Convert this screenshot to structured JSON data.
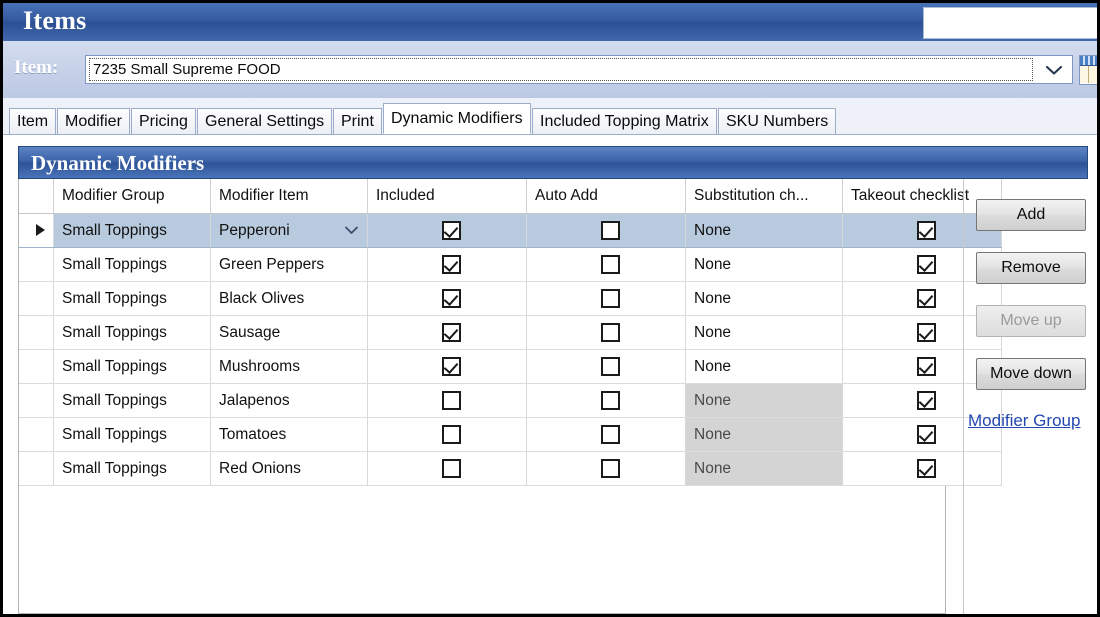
{
  "window": {
    "title": "Items"
  },
  "item_bar": {
    "label": "Item:",
    "value": "7235 Small Supreme FOOD",
    "placeholder": "",
    "dropdown_icon": "chevron-down-icon",
    "grid_icon": "table-grid-icon"
  },
  "tabs": [
    {
      "label": "Item",
      "active": false
    },
    {
      "label": "Modifier",
      "active": false
    },
    {
      "label": "Pricing",
      "active": false
    },
    {
      "label": "General Settings",
      "active": false
    },
    {
      "label": "Print",
      "active": false
    },
    {
      "label": "Dynamic Modifiers",
      "active": true
    },
    {
      "label": "Included Topping Matrix",
      "active": false
    },
    {
      "label": "SKU Numbers",
      "active": false
    }
  ],
  "panel": {
    "header": "Dynamic Modifiers"
  },
  "grid": {
    "columns": [
      "Modifier Group",
      "Modifier Item",
      "Included",
      "Auto Add",
      "Substitution ch...",
      "Takeout checklist"
    ],
    "rows": [
      {
        "selected": true,
        "dropdown": true,
        "modifier_group": "Small Toppings",
        "modifier_item": "Pepperoni",
        "included": true,
        "auto_add": false,
        "substitution": "None",
        "substitution_disabled": false,
        "takeout": true
      },
      {
        "selected": false,
        "dropdown": false,
        "modifier_group": "Small Toppings",
        "modifier_item": "Green Peppers",
        "included": true,
        "auto_add": false,
        "substitution": "None",
        "substitution_disabled": false,
        "takeout": true
      },
      {
        "selected": false,
        "dropdown": false,
        "modifier_group": "Small Toppings",
        "modifier_item": "Black Olives",
        "included": true,
        "auto_add": false,
        "substitution": "None",
        "substitution_disabled": false,
        "takeout": true
      },
      {
        "selected": false,
        "dropdown": false,
        "modifier_group": "Small Toppings",
        "modifier_item": "Sausage",
        "included": true,
        "auto_add": false,
        "substitution": "None",
        "substitution_disabled": false,
        "takeout": true
      },
      {
        "selected": false,
        "dropdown": false,
        "modifier_group": "Small Toppings",
        "modifier_item": "Mushrooms",
        "included": true,
        "auto_add": false,
        "substitution": "None",
        "substitution_disabled": false,
        "takeout": true
      },
      {
        "selected": false,
        "dropdown": false,
        "modifier_group": "Small Toppings",
        "modifier_item": "Jalapenos",
        "included": false,
        "auto_add": false,
        "substitution": "None",
        "substitution_disabled": true,
        "takeout": true
      },
      {
        "selected": false,
        "dropdown": false,
        "modifier_group": "Small Toppings",
        "modifier_item": "Tomatoes",
        "included": false,
        "auto_add": false,
        "substitution": "None",
        "substitution_disabled": true,
        "takeout": true
      },
      {
        "selected": false,
        "dropdown": false,
        "modifier_group": "Small Toppings",
        "modifier_item": "Red Onions",
        "included": false,
        "auto_add": false,
        "substitution": "None",
        "substitution_disabled": true,
        "takeout": true
      }
    ]
  },
  "side_buttons": [
    {
      "label": "Add",
      "disabled": false
    },
    {
      "label": "Remove",
      "disabled": false
    },
    {
      "label": "Move up",
      "disabled": true
    },
    {
      "label": "Move down",
      "disabled": false
    }
  ],
  "side_link": {
    "label": "Modifier Group"
  },
  "colors": {
    "titlebar_blue": "#33589c",
    "panel_header_blue": "#3b63a8",
    "selected_row": "#b8cade",
    "disabled_cell": "#d4d4d4",
    "link_blue": "#2347b0"
  }
}
